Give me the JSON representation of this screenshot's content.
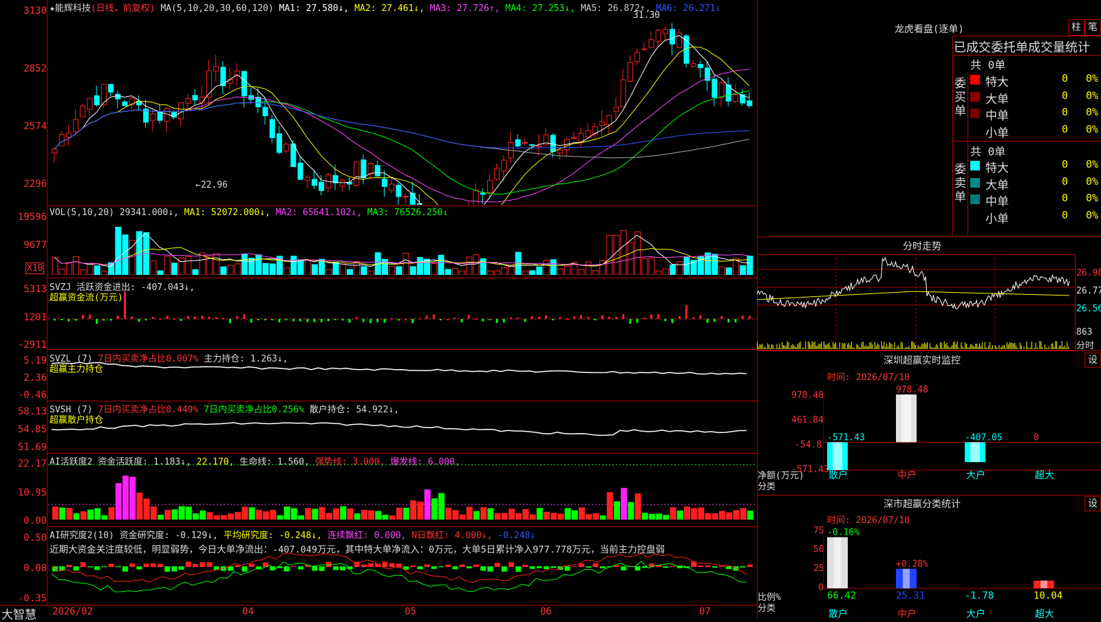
{
  "main_chart": {
    "title": "★能辉科技",
    "mode": "(日线，前复权)",
    "ma_label": "MA(5,10,20,30,60,120)",
    "ma1": "MA1: 27.580↓,",
    "ma2": "MA2: 27.461↓,",
    "ma3": "MA3: 27.726↑,",
    "ma4": "MA4: 27.253↓,",
    "ma5": "MA5: 26.872↑,",
    "ma6": "MA6: 26.271↓",
    "y_ticks": [
      "3130",
      "2852",
      "2574",
      "2296"
    ],
    "high_label": "31.30",
    "low_label": "←22.96"
  },
  "volume": {
    "label": "VOL(5,10,20)",
    "value": "29341.000↓,",
    "ma1": "MA1: 52072.000↓,",
    "ma2": "MA2: 65641.102↓,",
    "ma3": "MA3: 76526.250↓",
    "y_ticks": [
      "19596",
      "9677"
    ],
    "unit": "X10"
  },
  "svzj": {
    "label": "SVZJ  活跃资金进出: -407.043↓,",
    "sub": "超赢资金流(万元)",
    "y_ticks": [
      "5313",
      "1201",
      "-2911"
    ]
  },
  "svzl": {
    "label": "SVZL (7)",
    "ratio": "7日内买卖净占比0.007%",
    "hold": "主力持仓: 1.263↓,",
    "sub": "超赢主力持仓",
    "y_ticks": [
      "5.19",
      "2.36",
      "-0.46"
    ]
  },
  "svsh": {
    "label": "SVSH (7)",
    "ratio1": "7日内买卖净占比0.449%",
    "ratio2": "7日内买卖净占比0.256%",
    "hold": "散户持仓: 54.922↓,",
    "sub": "超赢散户持仓",
    "y_ticks": [
      "58.13",
      "54.85",
      "51.69"
    ]
  },
  "ai_active": {
    "label": "AI活跃度2 资金活跃度: 1.183↓,",
    "v2": "22.170,",
    "life": "生命线: 1.560,",
    "strong": "强势线: 3.000,",
    "burst": "爆发线: 6.000,",
    "y_ticks": [
      "22.17",
      "10.95",
      "0.00"
    ]
  },
  "ai_research": {
    "label": "AI研究度2(10) 资金研究度: -0.129↓,",
    "avg": "平均研究度: -0.248↓,",
    "red": "连续飘红: 0.000,",
    "nred": "N日飘红: 4.000↓,",
    "last": "-0.248↓",
    "comment": "近期大资金关注度较低，明显弱势，今日大单净流出：-407.049万元，其中特大单净流入：0万元，大单5日累计净入977.778万元，当前主力控盘弱",
    "y_ticks": [
      "0.50",
      "0.08",
      "-0.35"
    ]
  },
  "x_axis": {
    "brand": "大智慧",
    "labels": [
      "2026/02",
      "04",
      "05",
      "06",
      "07"
    ]
  },
  "right_top": {
    "title": "龙虎看盘(逐单)",
    "btn_bar": "柱",
    "btn_detail": "笔",
    "stats_title": "已成交委托单成交量统计",
    "buy_side": "委买单",
    "sell_side": "委卖单",
    "buy_total": "共 0单",
    "sell_total": "共 0单",
    "rows": [
      {
        "label": "特大",
        "count": "0",
        "pct": "0%"
      },
      {
        "label": "大单",
        "count": "0",
        "pct": "0%"
      },
      {
        "label": "中单",
        "count": "0",
        "pct": "0%"
      },
      {
        "label": "小单",
        "count": "0",
        "pct": "0%"
      }
    ],
    "buy_colors": [
      "#ff0000",
      "#8b0000",
      "#7a0000",
      "#000000"
    ],
    "sell_colors": [
      "#00ffff",
      "#008b8b",
      "#007a7a",
      "#000000"
    ]
  },
  "intraday": {
    "title": "分时走势",
    "prices": [
      "26.98",
      "26.77",
      "26.56"
    ],
    "vol": "863",
    "vol_label": "分时"
  },
  "sz_monitor": {
    "title": "深圳超赢实时监控",
    "set": "设",
    "date": "时间: 2026/07/10",
    "y_ticks": [
      "978.48",
      "461.84",
      "-54.8",
      "-571.43"
    ],
    "bars": [
      {
        "cat": "散户",
        "value": -571.43,
        "label": "-571.43"
      },
      {
        "cat": "中户",
        "value": 978.48,
        "label": "978.48"
      },
      {
        "cat": "大户",
        "value": -407.05,
        "label": "-407.05"
      },
      {
        "cat": "超大",
        "value": 0,
        "label": "0"
      }
    ],
    "ylabel": "净额(万元)",
    "xlabel": "分类"
  },
  "sz_class": {
    "title": "深市超赢分类统计",
    "set": "设",
    "date": "时间: 2026/07/10",
    "y_ticks": [
      "75",
      "50",
      "25",
      "0"
    ],
    "bars": [
      {
        "cat": "散户",
        "value": 66.42,
        "label": "66.42",
        "change": "-0.16%"
      },
      {
        "cat": "中户",
        "value": 25.31,
        "label": "25.31",
        "change": "+0.28%"
      },
      {
        "cat": "大户",
        "value": -1.78,
        "label": "-1.78",
        "change": ""
      },
      {
        "cat": "超大",
        "value": 10.04,
        "label": "10.04",
        "change": ""
      }
    ],
    "ylabel": "比例%",
    "xlabel": "分类"
  }
}
